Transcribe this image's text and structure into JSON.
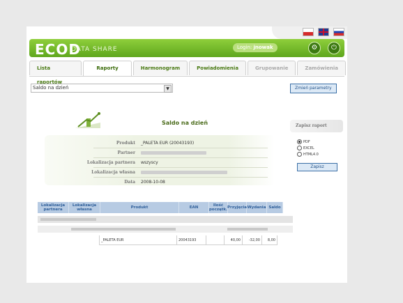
{
  "header": {
    "logo": "ECOD",
    "logo_sub": "DATA SHARE",
    "login_label": "Login:",
    "login_user": "jnowak"
  },
  "tabs": [
    {
      "label": "Lista raportów",
      "state": "normal"
    },
    {
      "label": "Raporty",
      "state": "active"
    },
    {
      "label": "Harmonogram",
      "state": "normal"
    },
    {
      "label": "Powiadomienia",
      "state": "normal"
    },
    {
      "label": "Grupowanie",
      "state": "disabled"
    },
    {
      "label": "Zamówienia",
      "state": "disabled"
    }
  ],
  "toolbar": {
    "select_value": "Saldo na dzień",
    "params_button": "Zmień parametry"
  },
  "report": {
    "title": "Saldo na dzień",
    "fields": [
      {
        "label": "Produkt",
        "value": "_PALETA EUR (20043193)"
      },
      {
        "label": "Partner",
        "value": ""
      },
      {
        "label": "Lokalizacja partnera",
        "value": "wszyscy"
      },
      {
        "label": "Lokalizacja własna",
        "value": ""
      },
      {
        "label": "Data",
        "value": "2008-10-08"
      }
    ]
  },
  "save_panel": {
    "title": "Zapisz raport",
    "options": [
      "PDF",
      "EXCEL",
      "HTML4.0"
    ],
    "selected": "PDF",
    "button": "Zapisz"
  },
  "table": {
    "columns": [
      "Lokalizacja partnera",
      "Lokalizacja własna",
      "Produkt",
      "EAN",
      "Ilość początk.",
      "Przyjęcia",
      "Wydania",
      "Saldo"
    ],
    "row": {
      "produkt": "_PALETA EUR",
      "ean": "20043193",
      "ilosc": "",
      "przyjecia": "40,00",
      "wydania": "-32,00",
      "saldo": "8,00"
    }
  },
  "colors": {
    "header_green": "#6cb324",
    "table_header": "#b7cbe3",
    "button_blue": "#dce9f6"
  }
}
